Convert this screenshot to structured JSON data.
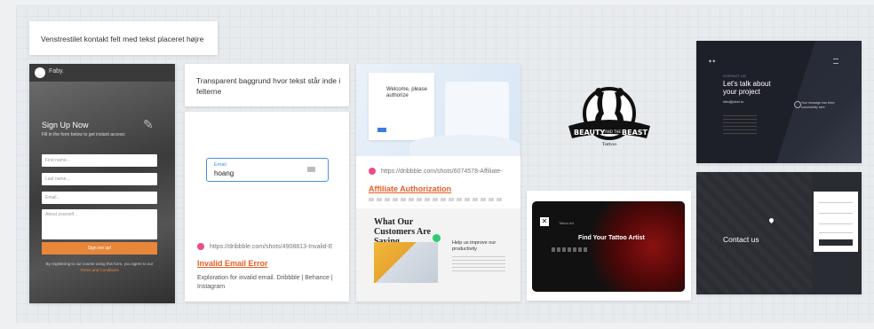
{
  "notes": {
    "contact_note": "Venstrestilet kontakt felt med tekst placeret højre",
    "transparent_note": "Transparent baggrund hvor tekst står inde i felterne"
  },
  "faby": {
    "brand": "Faby.",
    "title": "Sign Up Now",
    "subtitle": "Fill in the form below to get instant access:",
    "first_name": "First name...",
    "last_name": "Last name...",
    "email": "Email...",
    "about": "About yourself...",
    "button": "Sign me up!",
    "legal_prefix": "By registering to our course using this form, you agree to our",
    "legal_link": "Terms and Conditions",
    "accent": "#e8863a"
  },
  "email_demo": {
    "label": "Email",
    "value": "hoang",
    "source_url": "https://dribbble.com/shots/4908813-Invalid-E",
    "title": "Invalid Email Error",
    "description": "Exploration for invalid email. Dribbble | Behance | Instagram"
  },
  "affiliate": {
    "welcome": "Welcome, please authorize",
    "source_url": "https://dribbble.com/shots/6074578-Affiliate-",
    "title": "Affiliate Authorization",
    "testimonials_heading": "What Our Customers Are Saying",
    "help_text": "Help us improve our productivity"
  },
  "logo": {
    "text_left": "BEAUTY",
    "text_mid": "AND THE",
    "text_right": "BEAST",
    "tagline": "Tattoo"
  },
  "tattoo": {
    "brand": "Tattoo Art",
    "title": "Find Your Tattoo Artist"
  },
  "talk": {
    "kicker": "CONTACT US",
    "heading": "Let's talk about your project",
    "email": "info@pixel.io",
    "message": "Your message has been successfully sent"
  },
  "contact": {
    "title": "Contact us"
  },
  "link_color": "#e85d25",
  "dribbble_color": "#ea4c89"
}
